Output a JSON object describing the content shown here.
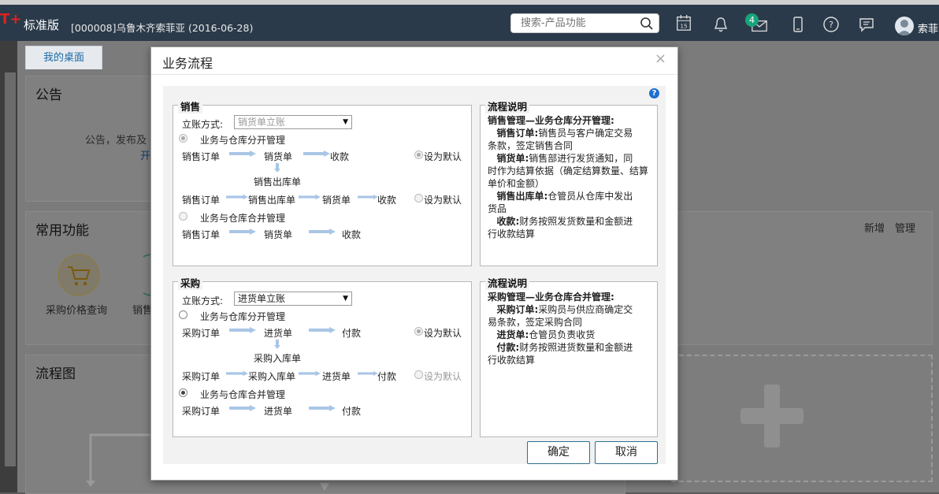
{
  "header": {
    "logo": "T+",
    "edition": "标准版",
    "company": "[000008]乌鲁木齐索菲亚   (2016-06-28)",
    "search_placeholder": "搜索-产品功能",
    "calendar_day": "15",
    "message_count": "4",
    "username": "索菲"
  },
  "desk": {
    "tab": "我的桌面",
    "notice_title": "公告",
    "notice_text": "公告，发布及",
    "notice_link": "开",
    "common_title": "常用功能",
    "common_add": "新增",
    "common_manage": "管理",
    "common_item1": "采购价格查询",
    "common_item2": "销售",
    "flow_title": "流程图"
  },
  "modal": {
    "title": "业务流程",
    "close": "×",
    "help": "?",
    "ok": "确定",
    "cancel": "取消",
    "sales": {
      "legend": "销售",
      "method_label": "立账方式:",
      "method_value": "销货单立账",
      "opt1": "业务与仓库分开管理",
      "opt2": "业务与仓库合并管理",
      "row1": [
        "销售订单",
        "销货单",
        "收款"
      ],
      "row1_sub": "销售出库单",
      "row2": [
        "销售订单",
        "销售出库单",
        "销货单",
        "收款"
      ],
      "row3": [
        "销售订单",
        "销货单",
        "收款"
      ],
      "default": "设为默认"
    },
    "sales_desc": {
      "legend": "流程说明",
      "heading": "销售管理—业务仓库分开管理:",
      "l1k": "销售订单:",
      "l1": "销售员与客户确定交易",
      "l1b": "条款，签定销售合同",
      "l2k": "销货单:",
      "l2": "销售部进行发货通知，同",
      "l2b": "时作为结算依据（确定结算数量、结算",
      "l2c": "单价和金额）",
      "l3k": "销售出库单:",
      "l3": "仓管员从仓库中发出",
      "l3b": "货品",
      "l4k": "收款:",
      "l4": "财务按照发货数量和金额进",
      "l4b": "行收款结算"
    },
    "purchase": {
      "legend": "采购",
      "method_label": "立账方式:",
      "method_value": "进货单立账",
      "opt1": "业务与仓库分开管理",
      "opt2": "业务与仓库合并管理",
      "row1": [
        "采购订单",
        "进货单",
        "付款"
      ],
      "row1_sub": "采购入库单",
      "row2": [
        "采购订单",
        "采购入库单",
        "进货单",
        "付款"
      ],
      "row3": [
        "采购订单",
        "进货单",
        "付款"
      ],
      "default": "设为默认"
    },
    "purchase_desc": {
      "legend": "流程说明",
      "heading": "采购管理—业务仓库合并管理:",
      "l1k": "采购订单:",
      "l1": "采购员与供应商确定交",
      "l1b": "易条款，签定采购合同",
      "l2k": "进货单:",
      "l2": "仓管员负责收货",
      "l3k": "付款:",
      "l3": "财务按照进货数量和金额进",
      "l3b": "行收款结算"
    }
  }
}
